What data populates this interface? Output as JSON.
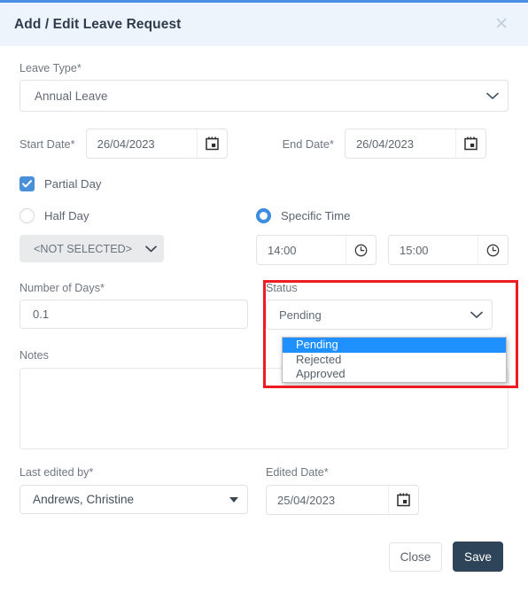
{
  "header": {
    "title": "Add / Edit Leave Request",
    "close_icon": "close-icon"
  },
  "form": {
    "leave_type": {
      "label": "Leave Type*",
      "value": "Annual Leave"
    },
    "start_date": {
      "label": "Start Date*",
      "value": "26/04/2023",
      "icon": "calendar-icon"
    },
    "end_date": {
      "label": "End Date*",
      "value": "26/04/2023",
      "icon": "calendar-icon"
    },
    "partial_day": {
      "label": "Partial Day",
      "checked": true
    },
    "half_day": {
      "label": "Half Day",
      "checked": false,
      "select_value": "<NOT SELECTED>",
      "disabled": true
    },
    "specific_time": {
      "label": "Specific Time",
      "checked": true,
      "start_time": "14:00",
      "end_time": "15:00",
      "icon": "clock-icon"
    },
    "number_of_days": {
      "label": "Number of Days*",
      "value": "0.1"
    },
    "status": {
      "label": "Status",
      "value": "Pending",
      "open": true,
      "options": [
        {
          "label": "Pending",
          "selected": true
        },
        {
          "label": "Rejected",
          "selected": false
        },
        {
          "label": "Approved",
          "selected": false
        }
      ]
    },
    "notes": {
      "label": "Notes",
      "value": "",
      "placeholder": ""
    },
    "last_edited_by": {
      "label": "Last edited by*",
      "value": "Andrews, Christine"
    },
    "edited_date": {
      "label": "Edited Date*",
      "value": "25/04/2023",
      "icon": "calendar-icon"
    }
  },
  "footer": {
    "close_label": "Close",
    "save_label": "Save"
  },
  "colors": {
    "header_bg": "#eef4fc",
    "accent_blue": "#4a90e2",
    "highlight_red": "#ee1c22",
    "dropdown_selected": "#1e90ff",
    "save_bg": "#2d4459"
  }
}
